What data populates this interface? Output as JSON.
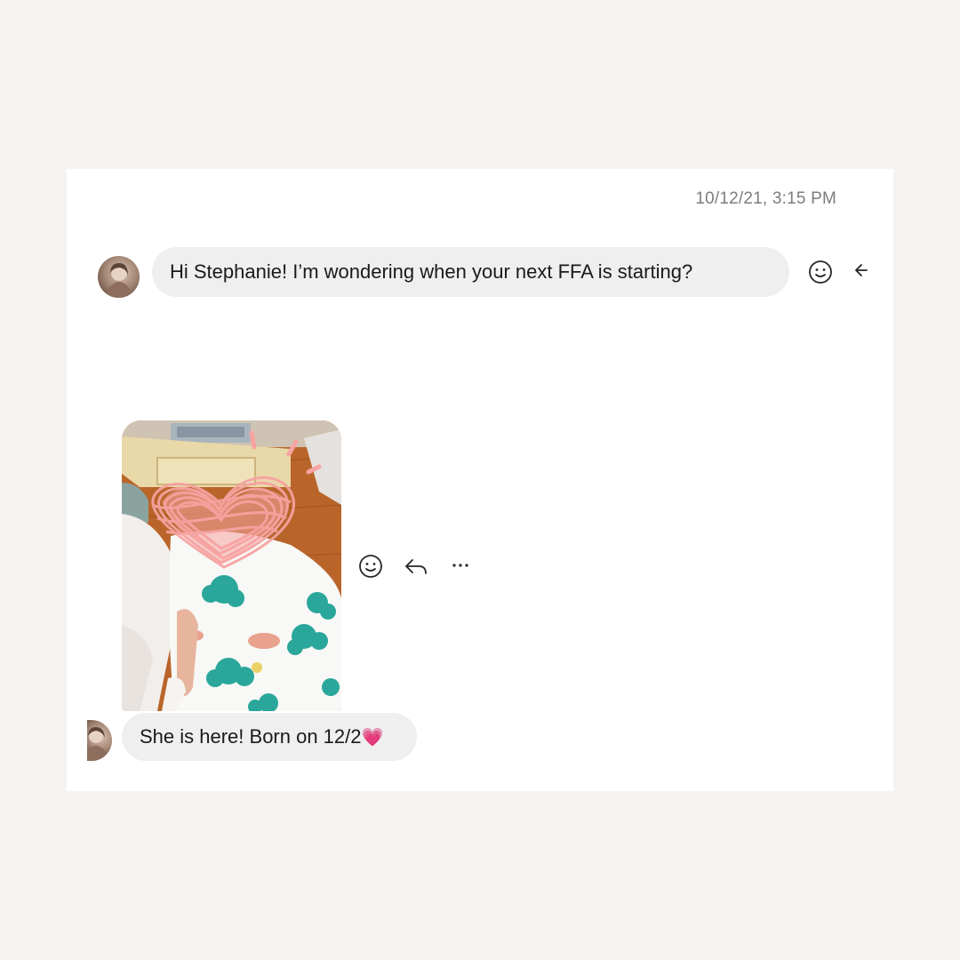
{
  "conversation": {
    "timestamp": "10/12/21, 3:15 PM",
    "messages": [
      {
        "type": "text",
        "text": "Hi Stephanie! I’m wondering when your next FFA is starting?",
        "actions": [
          "smile-icon",
          "reply-arrow-icon"
        ]
      },
      {
        "type": "photo",
        "actions": [
          "smile-icon",
          "reply-icon",
          "more-icon"
        ]
      },
      {
        "type": "text",
        "text": "She is here! Born on 12/2",
        "emoji": "💗"
      }
    ]
  },
  "colors": {
    "page_background": "#f6f3f0",
    "card_background": "#ffffff",
    "bubble_background": "#efefef",
    "timestamp_text": "#7c7c7c",
    "heart_scribble": "#f6a3a1",
    "emoji_heart": "#ff3fa4"
  }
}
